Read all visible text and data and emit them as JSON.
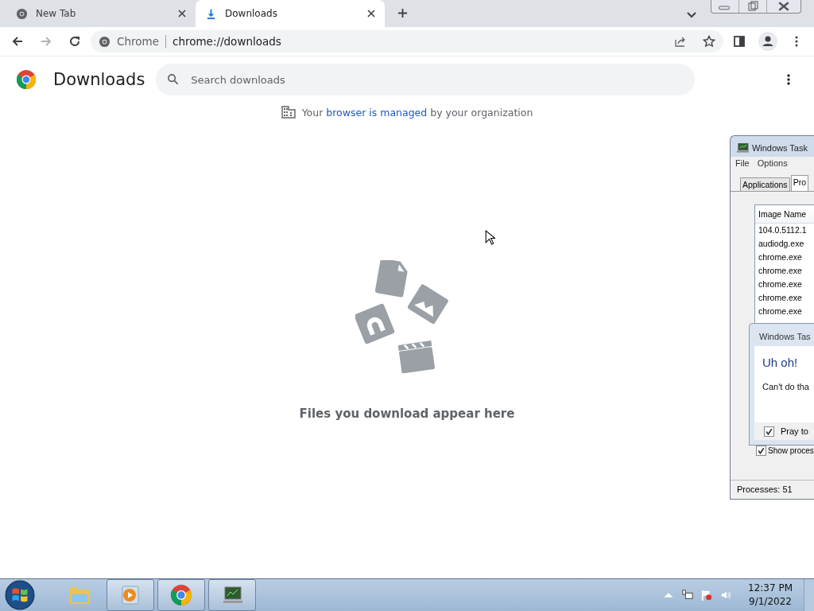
{
  "tabs": [
    {
      "title": "New Tab",
      "selected": false
    },
    {
      "title": "Downloads",
      "selected": true
    }
  ],
  "omnibox": {
    "origin": "Chrome",
    "url": "chrome://downloads"
  },
  "page": {
    "title": "Downloads",
    "search": {
      "placeholder": "Search downloads"
    },
    "managed_notice": {
      "before": "Your ",
      "link": "browser is managed",
      "after": " by your organization"
    },
    "empty_message": "Files you download appear here"
  },
  "task_manager": {
    "title": "Windows Task",
    "menu": [
      "File",
      "Options"
    ],
    "tabs": [
      {
        "label": "Applications",
        "selected": false
      },
      {
        "label": "Pro",
        "selected": true
      }
    ],
    "column": "Image Name",
    "rows": [
      "104.0.5112.1",
      "audiodg.exe",
      "chrome.exe",
      "chrome.exe",
      "chrome.exe",
      "chrome.exe",
      "chrome.exe"
    ],
    "show_processes": {
      "label": "Show proces",
      "checked": true
    },
    "status": "Processes: 51"
  },
  "dialog": {
    "title": "Windows Tas",
    "heading": "Uh oh!",
    "message": "Can't do tha",
    "checkbox": {
      "label": "Pray to",
      "checked": true
    }
  },
  "taskbar": {
    "apps": [
      {
        "kind": "explorer",
        "running": false
      },
      {
        "kind": "media",
        "running": true
      },
      {
        "kind": "chrome",
        "running": true
      },
      {
        "kind": "taskmgr",
        "running": true
      }
    ],
    "time": "12:37 PM",
    "date": "9/1/2022"
  }
}
